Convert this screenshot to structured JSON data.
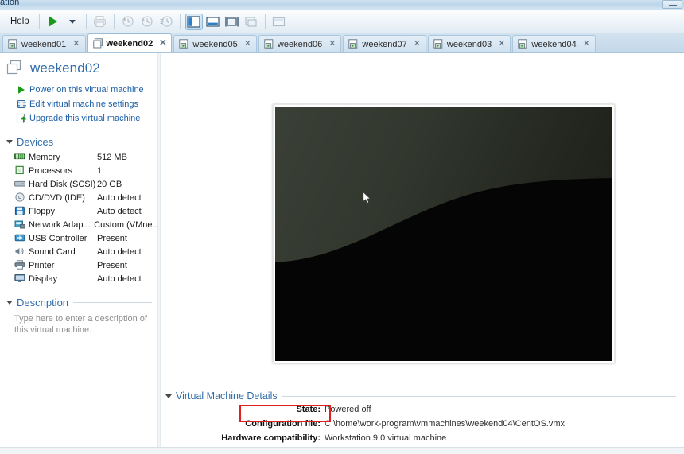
{
  "window": {
    "title_visible": "ation",
    "minimize_label": "minimize"
  },
  "toolbar": {
    "menu": [
      {
        "label": "Help",
        "name": "menu-help"
      }
    ],
    "buttons": [
      {
        "name": "power-on-button",
        "icon": "play-icon",
        "label": "Power on",
        "state": "enabled"
      },
      {
        "name": "power-dropdown-button",
        "icon": "chevron-down-icon",
        "label": "Power options",
        "state": "enabled"
      },
      {
        "name": "print-button",
        "icon": "printer-icon",
        "label": "Print",
        "state": "disabled"
      },
      {
        "name": "take-snapshot-button",
        "icon": "snapshot-add-icon",
        "label": "Take snapshot",
        "state": "disabled"
      },
      {
        "name": "revert-snapshot-button",
        "icon": "snapshot-revert-icon",
        "label": "Revert to snapshot",
        "state": "disabled"
      },
      {
        "name": "snapshot-manager-button",
        "icon": "snapshot-manager-icon",
        "label": "Manage snapshots",
        "state": "disabled"
      },
      {
        "name": "show-library-button",
        "icon": "sidebar-panel-icon",
        "label": "Show or hide the library",
        "state": "active"
      },
      {
        "name": "show-thumbnail-bar-button",
        "icon": "thumbnail-bar-icon",
        "label": "Show or hide thumbnail bar",
        "state": "enabled"
      },
      {
        "name": "full-screen-button",
        "icon": "fullscreen-icon",
        "label": "Enter full screen mode",
        "state": "enabled"
      },
      {
        "name": "unity-button",
        "icon": "unity-icon",
        "label": "Unity mode",
        "state": "disabled"
      },
      {
        "name": "console-view-button",
        "icon": "console-view-icon",
        "label": "Console view",
        "state": "disabled"
      }
    ]
  },
  "tabs": [
    {
      "label": "weekend01",
      "active": false
    },
    {
      "label": "weekend02",
      "active": true
    },
    {
      "label": "weekend05",
      "active": false
    },
    {
      "label": "weekend06",
      "active": false
    },
    {
      "label": "weekend07",
      "active": false
    },
    {
      "label": "weekend03",
      "active": false
    },
    {
      "label": "weekend04",
      "active": false
    }
  ],
  "sidebar": {
    "vm_name": "weekend02",
    "actions": [
      {
        "label": "Power on this virtual machine",
        "icon": "play-icon"
      },
      {
        "label": "Edit virtual machine settings",
        "icon": "settings-icon"
      },
      {
        "label": "Upgrade this virtual machine",
        "icon": "upgrade-icon"
      }
    ],
    "devices_header": "Devices",
    "devices": [
      {
        "name": "Memory",
        "value": "512 MB",
        "icon": "memory-icon"
      },
      {
        "name": "Processors",
        "value": "1",
        "icon": "processor-icon"
      },
      {
        "name": "Hard Disk (SCSI)",
        "value": "20 GB",
        "icon": "harddisk-icon"
      },
      {
        "name": "CD/DVD (IDE)",
        "value": "Auto detect",
        "icon": "cddvd-icon"
      },
      {
        "name": "Floppy",
        "value": "Auto detect",
        "icon": "floppy-icon"
      },
      {
        "name": "Network Adap...",
        "value": "Custom (VMne...",
        "icon": "network-icon"
      },
      {
        "name": "USB Controller",
        "value": "Present",
        "icon": "usb-icon"
      },
      {
        "name": "Sound Card",
        "value": "Auto detect",
        "icon": "sound-icon"
      },
      {
        "name": "Printer",
        "value": "Present",
        "icon": "printer-icon"
      },
      {
        "name": "Display",
        "value": "Auto detect",
        "icon": "display-icon"
      }
    ],
    "description_header": "Description",
    "description_placeholder": "Type here to enter a description of this virtual machine."
  },
  "details": {
    "header": "Virtual Machine Details",
    "rows": [
      {
        "key": "State:",
        "value": "Powered off",
        "highlighted": true
      },
      {
        "key": "Configuration file:",
        "value": "C:\\home\\work-program\\vmmachines\\weekend04\\CentOS.vmx",
        "highlighted": false
      },
      {
        "key": "Hardware compatibility:",
        "value": "Workstation 9.0 virtual machine",
        "highlighted": false
      }
    ]
  },
  "colors": {
    "link_blue": "#1d5fa6",
    "heading_blue": "#2f6ca8",
    "highlight_red": "#e02020",
    "play_green": "#199b19",
    "preview_top_left": "#3b4037",
    "preview_bottom_right": "#171a12"
  }
}
